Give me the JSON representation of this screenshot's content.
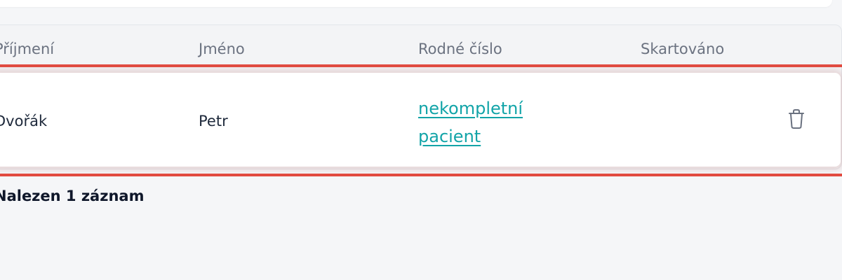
{
  "table": {
    "columns": [
      "Příjmení",
      "Jméno",
      "Rodné číslo",
      "Skartováno"
    ],
    "rows": [
      {
        "prijmeni": "Dvořák",
        "jmeno": "Petr",
        "rodne_cislo_link": "nekompletní pacient",
        "rodne_cislo_lines": [
          "nekompletní",
          "pacient"
        ],
        "skartovano": "",
        "action_icon": "trash-icon"
      }
    ]
  },
  "footer": {
    "result_count": "Nalezen 1 záznam"
  },
  "colors": {
    "highlight": "#e24b40",
    "link": "#12a4a8",
    "header_text": "#6b7280",
    "cell_text": "#1e293b"
  }
}
